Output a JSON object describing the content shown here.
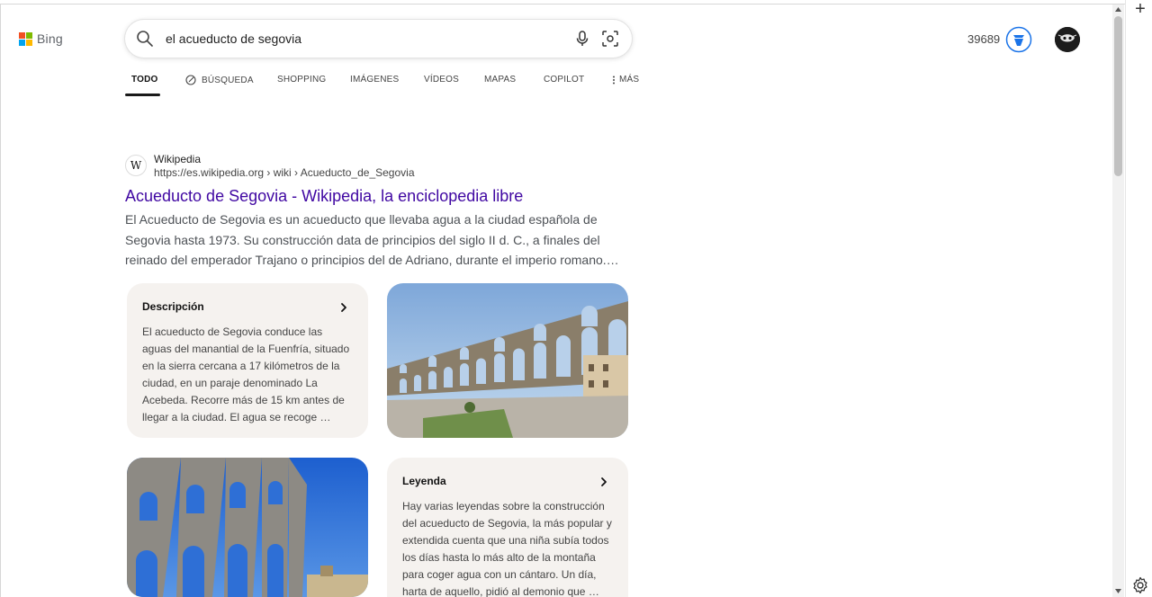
{
  "header": {
    "logo_text": "Bing",
    "search_query": "el acueducto de segovia",
    "points": "39689"
  },
  "tabs": [
    {
      "label": "TODO",
      "active": true
    },
    {
      "label": "BÚSQUEDA"
    },
    {
      "label": "SHOPPING"
    },
    {
      "label": "IMÁGENES"
    },
    {
      "label": "VÍDEOS"
    },
    {
      "label": "MAPAS"
    },
    {
      "label": "COPILOT"
    },
    {
      "label": "MÁS"
    }
  ],
  "result": {
    "site_icon": "W",
    "site_name": "Wikipedia",
    "url": "https://es.wikipedia.org › wiki › Acueducto_de_Segovia",
    "title": "Acueducto de Segovia - Wikipedia, la enciclopedia libre",
    "snippet": "El Acueducto de Segovia es un acueducto que llevaba agua a la ciudad española de Segovia hasta 1973.  Su construcción data de principios del siglo II d. C., a finales del reinado del emperador Trajano o principios del de Adriano, durante el imperio romano.…"
  },
  "cards": {
    "descripcion": {
      "title": "Descripción",
      "body": "El acueducto de Segovia conduce las aguas del manantial de la Fuenfría, situado en la sierra cercana a 17 kilómetros de la ciudad, en un paraje denominado La Acebeda. Recorre más de 15 km antes de llegar a la ciudad. El agua se recoge …"
    },
    "leyenda": {
      "title": "Leyenda",
      "body": "Hay varias leyendas sobre la construcción del acueducto de Segovia, la más popular y extendida cuenta que una niña subía todos los días hasta lo más alto de la montaña para coger agua con un cántaro.  Un día, harta de aquello, pidió al demonio que …"
    }
  },
  "icons": {
    "search": "search-icon",
    "mic": "microphone-icon",
    "visual_search": "visual-search-icon",
    "rewards": "rewards-icon",
    "more": "more-vertical-icon",
    "chevron": "chevron-right-icon",
    "settings": "gear-icon",
    "new_tab": "plus-icon"
  },
  "colors": {
    "title_link": "#4007a2",
    "logo_red": "#f25022",
    "logo_green": "#7fba00",
    "logo_blue": "#00a4ef",
    "logo_yellow": "#ffb900",
    "rewards_blue": "#1a73e8",
    "card_bg": "#f5f2ef"
  }
}
